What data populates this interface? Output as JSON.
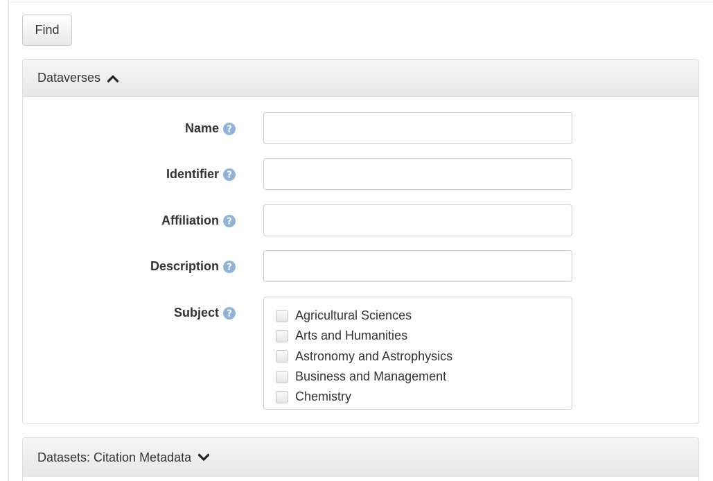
{
  "toolbar": {
    "find_label": "Find"
  },
  "dataverses_panel": {
    "title": "Dataverses",
    "expanded": true,
    "toggle_icon": "chevron-up-icon",
    "fields": [
      {
        "label": "Name",
        "value": "",
        "help_icon": "question-circle-icon"
      },
      {
        "label": "Identifier",
        "value": "",
        "help_icon": "question-circle-icon"
      },
      {
        "label": "Affiliation",
        "value": "",
        "help_icon": "question-circle-icon"
      },
      {
        "label": "Description",
        "value": "",
        "help_icon": "question-circle-icon"
      }
    ],
    "subject": {
      "label": "Subject",
      "help_icon": "question-circle-icon",
      "options": [
        {
          "label": "Agricultural Sciences",
          "checked": false
        },
        {
          "label": "Arts and Humanities",
          "checked": false
        },
        {
          "label": "Astronomy and Astrophysics",
          "checked": false
        },
        {
          "label": "Business and Management",
          "checked": false
        },
        {
          "label": "Chemistry",
          "checked": false
        }
      ]
    }
  },
  "datasets_panel": {
    "title": "Datasets: Citation Metadata",
    "expanded": false,
    "toggle_icon": "chevron-down-icon"
  },
  "colors": {
    "help_icon": "#8fb3d9",
    "panel_heading_bg": "#f0f0f0",
    "border": "#dddddd",
    "text": "#333333"
  }
}
